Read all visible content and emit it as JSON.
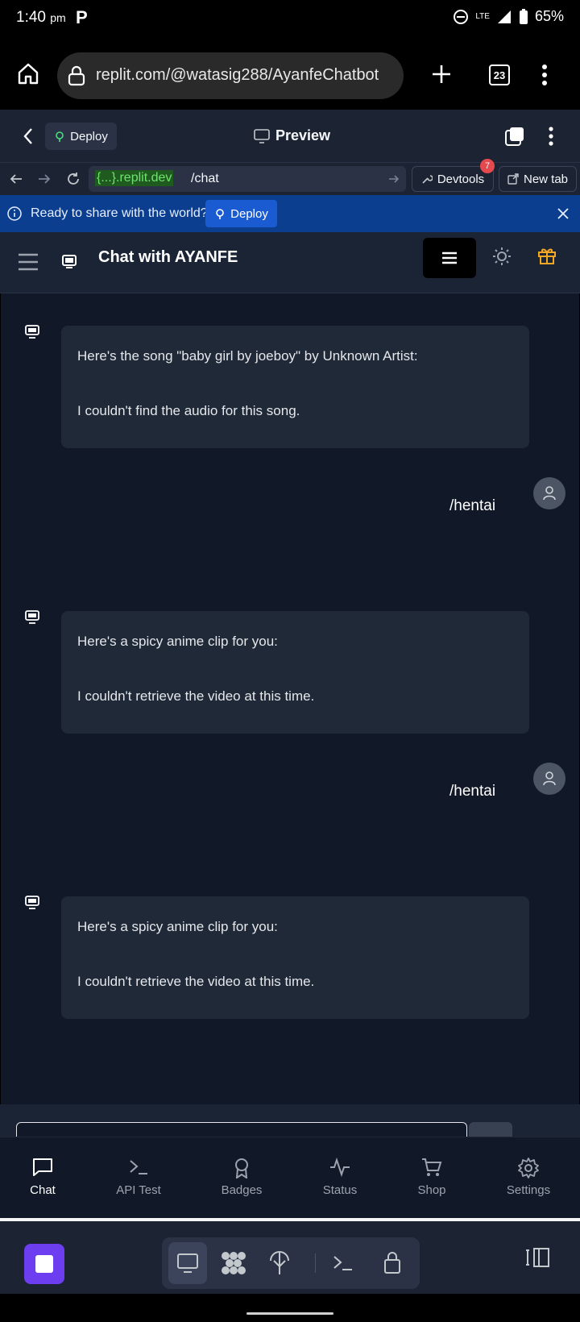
{
  "status_bar": {
    "time": "1:40",
    "time_suffix": "pm",
    "app_letter": "P",
    "network": "LTE",
    "battery": "65%"
  },
  "browser": {
    "url": "replit.com/@watasig288/AyanfeChatbot",
    "tab_count": "23"
  },
  "replit_header": {
    "deploy_label": "Deploy",
    "preview_label": "Preview"
  },
  "address_row": {
    "host_prefix": "{...}",
    "host_suffix": ".replit.dev",
    "path": "/chat",
    "devtools_label": "Devtools",
    "devtools_badge": "7",
    "new_tab_label": "New tab"
  },
  "banner": {
    "text": "Ready to share with the world?",
    "deploy_label": "Deploy"
  },
  "app": {
    "title": "Chat with AYANFE"
  },
  "messages": [
    {
      "role": "bot",
      "line1": "Here's the song \"baby girl by joeboy\" by Unknown Artist:",
      "line2": "I couldn't find the audio for this song."
    },
    {
      "role": "user",
      "text": "/hentai"
    },
    {
      "role": "bot",
      "line1": "Here's a spicy anime clip for you:",
      "line2": "I couldn't retrieve the video at this time."
    },
    {
      "role": "user",
      "text": "/hentai"
    },
    {
      "role": "bot",
      "line1": "Here's a spicy anime clip for you:",
      "line2": "I couldn't retrieve the video at this time."
    }
  ],
  "nav": {
    "items": [
      {
        "label": "Chat",
        "icon": "chat-icon"
      },
      {
        "label": "API Test",
        "icon": "terminal-icon"
      },
      {
        "label": "Badges",
        "icon": "badge-icon"
      },
      {
        "label": "Status",
        "icon": "activity-icon"
      },
      {
        "label": "Shop",
        "icon": "cart-icon"
      },
      {
        "label": "Settings",
        "icon": "gear-icon"
      }
    ],
    "active": "Chat"
  },
  "colors": {
    "chat_bg": "#111827",
    "bubble_bg": "#1f2937",
    "banner_bg": "#0b3e8f",
    "gift_accent": "#f5a623",
    "app_tile": "#6d3df0"
  }
}
